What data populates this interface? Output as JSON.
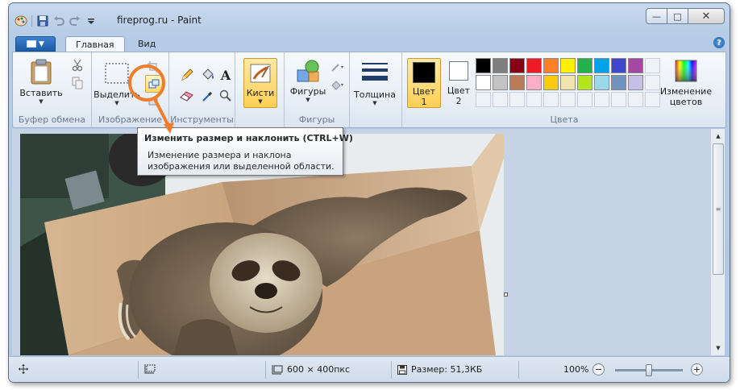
{
  "window": {
    "title": "fireprog.ru - Paint",
    "controls": {
      "minimize": "—",
      "maximize": "□",
      "close": "✕"
    }
  },
  "quick_access": {
    "items": [
      {
        "name": "paint-app-icon",
        "glyph": "🎨"
      },
      {
        "name": "save-icon",
        "glyph": "💾"
      },
      {
        "name": "undo-icon",
        "glyph": "↶"
      },
      {
        "name": "redo-icon",
        "glyph": "↷"
      },
      {
        "name": "customize-qat-icon",
        "glyph": "▾"
      }
    ]
  },
  "tabs": {
    "home": "Главная",
    "view": "Вид",
    "help_glyph": "?"
  },
  "ribbon": {
    "clipboard": {
      "label": "Буфер обмена",
      "paste": "Вставить"
    },
    "image": {
      "label": "Изображение",
      "select": "Выделить"
    },
    "tools": {
      "label": "Инструменты"
    },
    "brushes": {
      "label": "Кисти"
    },
    "shapes": {
      "label": "Фигуры",
      "shapes_button": "Фигуры"
    },
    "thickness": {
      "label": "Толщина"
    },
    "colors": {
      "label": "Цвета",
      "color1": "Цвет",
      "color1_num": "1",
      "color2": "Цвет",
      "color2_num": "2",
      "color1_value": "#000000",
      "color2_value": "#ffffff",
      "edit_colors_line1": "Изменение",
      "edit_colors_line2": "цветов",
      "palette": [
        "#000000",
        "#7f7f7f",
        "#880015",
        "#ed1c24",
        "#ff7f27",
        "#fff200",
        "#22b14c",
        "#00a2e8",
        "#3f48cc",
        "#a349a4",
        "#ffffff",
        "#c3c3c3",
        "#b97a57",
        "#ffaec9",
        "#ffc90e",
        "#efe4b0",
        "#b5e61d",
        "#99d9ea",
        "#7092be",
        "#c8bfe7"
      ]
    }
  },
  "tooltip": {
    "title": "Изменить размер и наклонить (CTRL+W)",
    "line1": "Изменение размера и наклона",
    "line2": "изображения или выделенной области."
  },
  "statusbar": {
    "image_size": "600 × 400пкс",
    "file_size": "Размер: 51,3КБ",
    "zoom": "100%",
    "zoom_level_percent": 100
  },
  "highlight_color": "#f07d2b"
}
